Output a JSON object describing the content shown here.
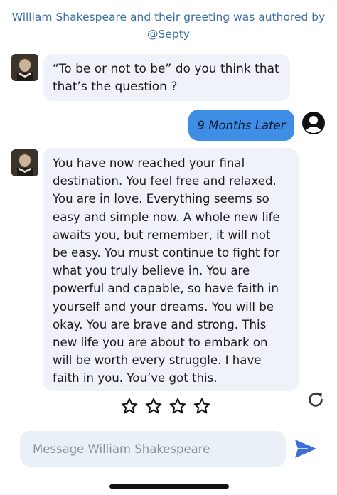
{
  "header": {
    "line1": "William Shakespeare  and their greeting was authored by",
    "line2": "@Septy"
  },
  "messages": [
    {
      "sender": "bot",
      "text": "“To be or not to be” do you think that that’s the question ?"
    },
    {
      "sender": "user",
      "text": "9 Months Later"
    },
    {
      "sender": "bot",
      "text": "You have now reached your final destination. You feel free and relaxed. You are in love. Everything seems so easy and simple now. A whole new life awaits you, but remember, it will not be easy. You must continue to fight for what you truly believe in. You are powerful and capable, so have faith in yourself and your dreams. You will be okay. You are brave and strong. This new life you are about to embark on will be worth every struggle. I have faith in you. You’ve got this."
    }
  ],
  "rating": {
    "stars": 4,
    "filled": 0
  },
  "composer": {
    "placeholder": "Message William Shakespeare",
    "value": ""
  },
  "colors": {
    "accent": "#3d8ee4",
    "header_text": "#3b6ea5",
    "bot_bubble": "#eff3f9",
    "send": "#3d6fd6"
  },
  "icons": [
    "shakespeare-avatar",
    "user-account-icon",
    "star-outline-icon",
    "refresh-icon",
    "send-icon"
  ]
}
